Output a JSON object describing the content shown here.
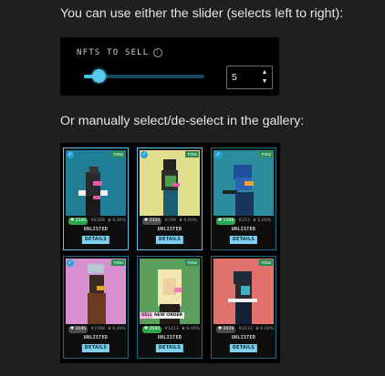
{
  "instructions": {
    "slider_hint": "You can use either the slider (selects left to right):",
    "gallery_hint": "Or manually select/de-select in the gallery:"
  },
  "slider": {
    "title": "NFTS TO SELL",
    "value": "5",
    "fill_fraction": 0.12
  },
  "icons": {
    "info": "info-icon",
    "check": "check-icon",
    "up": "up-arrow-icon",
    "down": "down-arrow-icon"
  },
  "cards": [
    {
      "bg": "#1f7e96",
      "selected": true,
      "you": "YOU",
      "likes": "2340",
      "id": "#6309",
      "score": "6.00%",
      "status": "UNLISTED",
      "details": "DETAILS",
      "heart_color": "green"
    },
    {
      "bg": "#e1de8e",
      "selected": true,
      "you": "YOU",
      "likes": "2310",
      "id": "#709",
      "score": "6.00%",
      "status": "UNLISTED",
      "details": "DETAILS",
      "heart_color": "gray"
    },
    {
      "bg": "#2b8c9e",
      "selected": false,
      "you": "YOU",
      "likes": "1598",
      "id": "#253",
      "score": "6.00%",
      "status": "UNLISTED",
      "details": "DETAILS",
      "heart_color": "green"
    },
    {
      "bg": "#d78fcf",
      "selected": false,
      "you": "YOU",
      "likes": "2045",
      "id": "#1598",
      "score": "6.00%",
      "status": "UNLISTED",
      "details": "DETAILS",
      "heart_color": "gray"
    },
    {
      "bg": "#5c9f5c",
      "selected": false,
      "you": "YOU",
      "likes": "2080",
      "id": "#1413",
      "score": "6.00%",
      "status": "UNLISTED",
      "details": "DETAILS",
      "heart_color": "green",
      "tags": [
        "SELL",
        "NEW ORDER"
      ]
    },
    {
      "bg": "#e0716c",
      "selected": false,
      "you": "YOU",
      "likes": "2029",
      "id": "#3133",
      "score": "6.00%",
      "status": "UNLISTED",
      "details": "DETAILS",
      "heart_color": "gray"
    }
  ]
}
